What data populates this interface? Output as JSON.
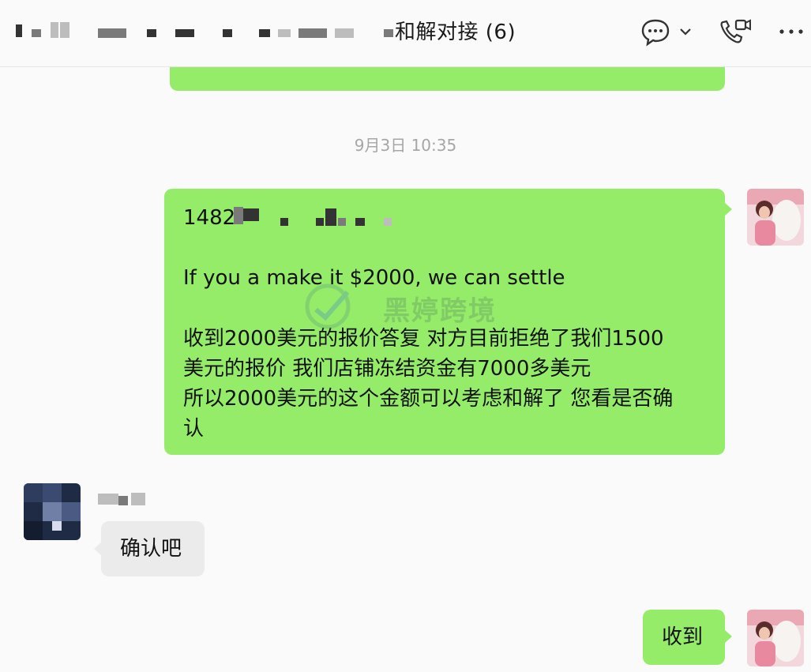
{
  "header": {
    "title": "和解对接 (6)",
    "icons": [
      "chat-bubble-icon",
      "chevron-down-icon",
      "video-call-icon",
      "more-icon"
    ]
  },
  "conversation": {
    "timestamp": "9月3日 10:35",
    "messages": [
      {
        "id": "msg1",
        "sender": "self",
        "line1": "1482",
        "line2": "If you a make it $2000, we can settle",
        "line3": "收到2000美元的报价答复 对方目前拒绝了我们1500",
        "line4": "美元的报价 我们店铺冻结资金有7000多美元",
        "line5": "所以2000美元的这个金额可以考虑和解了 您看是否确",
        "line6": "认"
      },
      {
        "id": "msg2",
        "sender": "other",
        "text": "确认吧"
      },
      {
        "id": "msg3",
        "sender": "self",
        "text": "收到"
      }
    ],
    "watermark": "黑婷跨境"
  },
  "colors": {
    "self_bubble": "#95ec69",
    "other_bubble": "#ebebeb",
    "background": "#fafafa"
  }
}
